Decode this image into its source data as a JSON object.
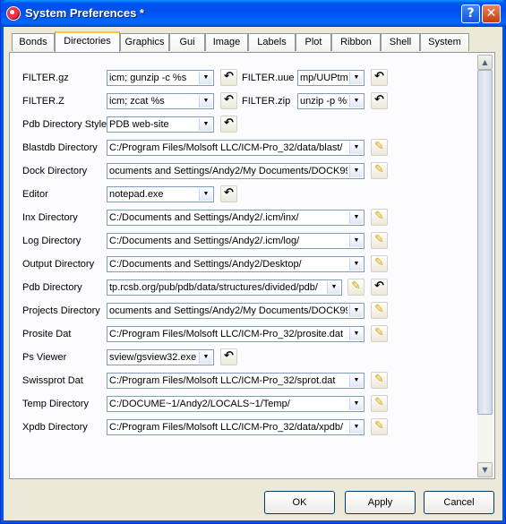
{
  "window": {
    "title": "System Preferences *"
  },
  "tabs": [
    "Bonds",
    "Directories",
    "Graphics",
    "Gui",
    "Image",
    "Labels",
    "Plot",
    "Ribbon",
    "Shell",
    "System"
  ],
  "rows": [
    {
      "label": "FILTER.gz",
      "value": "icm; gunzip -c %s",
      "button": "reset"
    },
    {
      "label": "FILTER.Z",
      "value": "icm; zcat %s",
      "button": "reset"
    },
    {
      "label": "Pdb Directory Style",
      "value": "PDB web-site",
      "button": "reset"
    },
    {
      "label": "Blastdb Directory",
      "value": "C:/Program Files/Molsoft LLC/ICM-Pro_32/data/blast/",
      "button": "edit"
    },
    {
      "label": "Dock Directory",
      "value": "ocuments and Settings/Andy2/My Documents/DOCK99",
      "button": "edit"
    },
    {
      "label": "Editor",
      "value": "notepad.exe",
      "button": "reset"
    },
    {
      "label": "Inx Directory",
      "value": "C:/Documents and Settings/Andy2/.icm/inx/",
      "button": "edit"
    },
    {
      "label": "Log Directory",
      "value": "C:/Documents and Settings/Andy2/.icm/log/",
      "button": "edit"
    },
    {
      "label": "Output Directory",
      "value": "C:/Documents and Settings/Andy2/Desktop/",
      "button": "edit"
    },
    {
      "label": "Pdb Directory",
      "value": "tp.rcsb.org/pub/pdb/data/structures/divided/pdb/",
      "button": "edit+reset"
    },
    {
      "label": "Projects Directory",
      "value": "ocuments and Settings/Andy2/My Documents/DOCK99",
      "button": "edit"
    },
    {
      "label": "Prosite Dat",
      "value": "C:/Program Files/Molsoft LLC/ICM-Pro_32/prosite.dat",
      "button": "edit"
    },
    {
      "label": "Ps Viewer",
      "value": "sview/gsview32.exe",
      "button": "reset"
    },
    {
      "label": "Swissprot Dat",
      "value": "C:/Program Files/Molsoft LLC/ICM-Pro_32/sprot.dat",
      "button": "edit"
    },
    {
      "label": "Temp Directory",
      "value": "C:/DOCUME~1/Andy2/LOCALS~1/Temp/",
      "button": "edit"
    },
    {
      "label": "Xpdb Directory",
      "value": "C:/Program Files/Molsoft LLC/ICM-Pro_32/data/xpdb/",
      "button": "edit"
    }
  ],
  "right_rows": [
    {
      "label": "FILTER.uue",
      "value": "mp/UUPtm"
    },
    {
      "label": "FILTER.zip",
      "value": "unzip -p %s"
    }
  ],
  "buttons": {
    "ok": "OK",
    "apply": "Apply",
    "cancel": "Cancel"
  },
  "icons": {
    "reset": "undo-arrow-icon",
    "edit": "pencil-icon",
    "dropdown": "chevron-down-icon"
  }
}
